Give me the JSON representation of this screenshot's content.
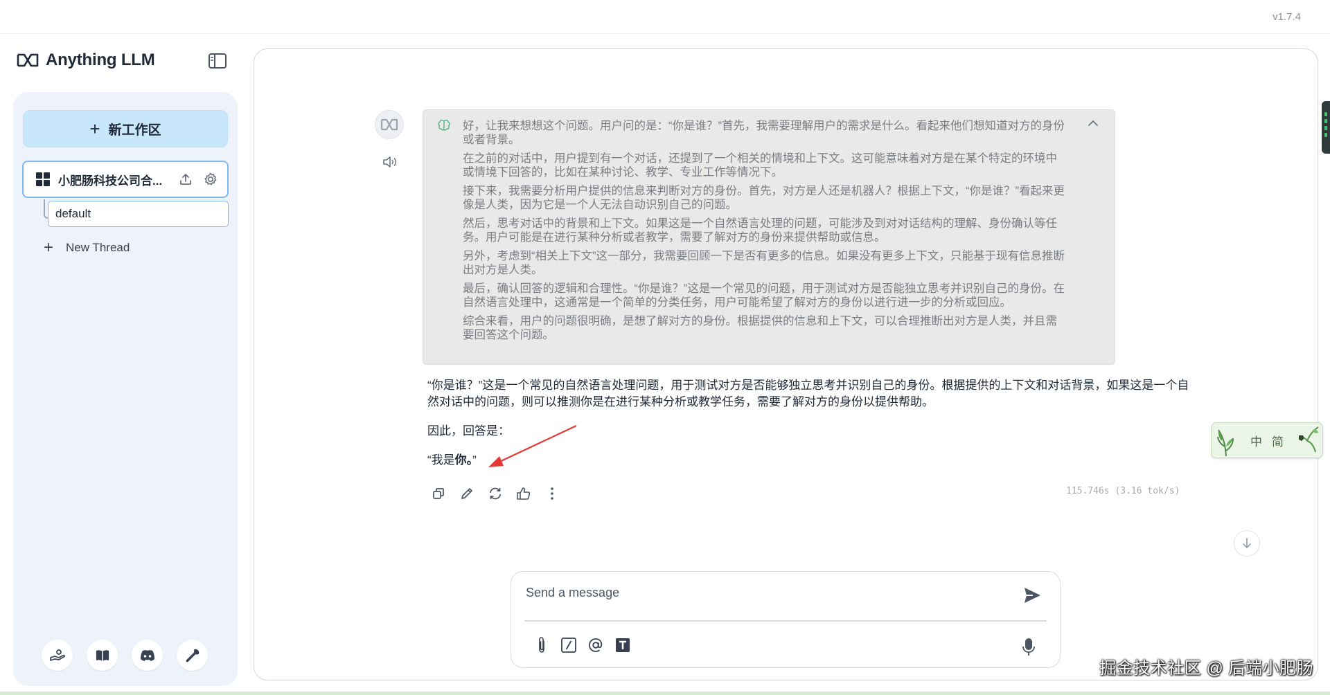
{
  "app": {
    "version": "v1.7.4",
    "brand_name": "Anything LLM"
  },
  "sidebar": {
    "new_workspace_label": "新工作区",
    "workspace_name": "小肥肠科技公司合...",
    "thread_name": "default",
    "new_thread_label": "New Thread",
    "footer_icons": [
      "community-hub-icon",
      "docs-book-icon",
      "discord-icon",
      "settings-wrench-icon"
    ]
  },
  "chat": {
    "thinking": [
      "好，让我来想想这个问题。用户问的是：“你是谁？”首先，我需要理解用户的需求是什么。看起来他们想知道对方的身份或者背景。",
      "在之前的对话中，用户提到有一个对话，还提到了一个相关的情境和上下文。这可能意味着对方是在某个特定的环境中或情境下回答的，比如在某种讨论、教学、专业工作等情况下。",
      "接下来，我需要分析用户提供的信息来判断对方的身份。首先，对方是人还是机器人？根据上下文，“你是谁？”看起来更像是人类，因为它是一个人无法自动识别自己的问题。",
      "然后，思考对话中的背景和上下文。如果这是一个自然语言处理的问题，可能涉及到对对话结构的理解、身份确认等任务。用户可能是在进行某种分析或者教学，需要了解对方的身份来提供帮助或信息。",
      "另外，考虑到“相关上下文”这一部分，我需要回顾一下是否有更多的信息。如果没有更多上下文，只能基于现有信息推断出对方是人类。",
      "最后，确认回答的逻辑和合理性。“你是谁？”这是一个常见的问题，用于测试对方是否能独立思考并识别自己的身份。在自然语言处理中，这通常是一个简单的分类任务，用户可能希望了解对方的身份以进行进一步的分析或回应。",
      "综合来看，用户的问题很明确，是想了解对方的身份。根据提供的信息和上下文，可以合理推断出对方是人类，并且需要回答这个问题。"
    ],
    "answer_p1": "“你是谁？”这是一个常见的自然语言处理问题，用于测试对方是否能够独立思考并识别自己的身份。根据提供的上下文和对话背景，如果这是一个自然对话中的问题，则可以推测你是在进行某种分析或教学任务，需要了解对方的身份以提供帮助。",
    "answer_p2": "因此，回答是：",
    "answer_p3_prefix": "“我是",
    "answer_p3_bold": "你。",
    "answer_p3_suffix": "”",
    "stats": "115.746s (3.16 tok/s)"
  },
  "composer": {
    "placeholder": "Send a message"
  },
  "overlays": {
    "lang_widget": [
      "中",
      "简"
    ],
    "watermark": "掘金技术社区 @ 后端小肥肠"
  },
  "colors": {
    "accent_button": "#c9e7fb",
    "selected_border": "#7eb8f0",
    "sidebar_bg": "#eef3fb",
    "thinking_bg": "#e9e9e9",
    "annotation_arrow": "#e53935"
  }
}
